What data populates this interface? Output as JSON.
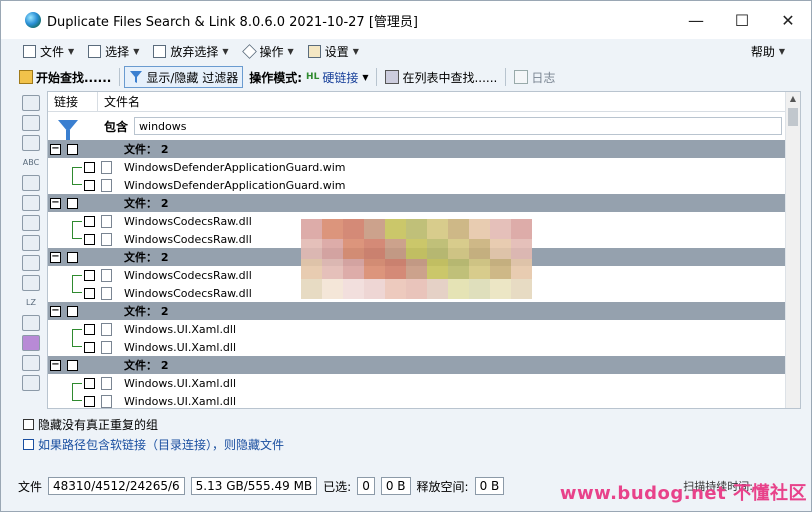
{
  "window": {
    "title": "Duplicate Files Search & Link 8.0.6.0 2021-10-27 [管理员]",
    "controls": {
      "minimize": "—",
      "maximize": "☐",
      "close": "✕"
    }
  },
  "menu": {
    "items": [
      {
        "label": "文件",
        "icon": "file-icon"
      },
      {
        "label": "选择",
        "icon": "check-icon"
      },
      {
        "label": "放弃选择",
        "icon": "uncheck-icon"
      },
      {
        "label": "操作",
        "icon": "diamond-icon"
      },
      {
        "label": "设置",
        "icon": "settings-icon"
      }
    ],
    "help": "帮助"
  },
  "toolbar": {
    "start_search": "开始查找......",
    "show_hide_filter": "显示/隐藏 过滤器",
    "mode_label": "操作模式:",
    "mode_value": "硬链接",
    "mode_badge": "HL",
    "find_in_list": "在列表中查找......",
    "log": "日志"
  },
  "lefttools": {
    "abc": "ABC",
    "lz": "LZ"
  },
  "list": {
    "col_link": "链接",
    "col_name": "文件名",
    "filter_label": "包含",
    "filter_value": "windows",
    "groups": [
      {
        "label": "文件： 2",
        "files": [
          "WindowsDefenderApplicationGuard.wim",
          "WindowsDefenderApplicationGuard.wim"
        ]
      },
      {
        "label": "文件： 2",
        "files": [
          "WindowsCodecsRaw.dll",
          "WindowsCodecsRaw.dll"
        ]
      },
      {
        "label": "文件： 2",
        "files": [
          "WindowsCodecsRaw.dll",
          "WindowsCodecsRaw.dll"
        ]
      },
      {
        "label": "文件： 2",
        "files": [
          "Windows.UI.Xaml.dll",
          "Windows.UI.Xaml.dll"
        ]
      },
      {
        "label": "文件： 2",
        "files": [
          "Windows.UI.Xaml.dll",
          "Windows.UI.Xaml.dll"
        ]
      }
    ]
  },
  "options": {
    "hide_groups": "隐藏没有真正重复的组",
    "hide_symlinks": "如果路径包含软链接（目录连接），则隐藏文件"
  },
  "status": {
    "files_label": "文件",
    "files_counts": "48310/4512/24265/6",
    "sizes": "5.13 GB/555.49 MB",
    "selected_label": "已选:",
    "selected_count": "0",
    "selected_size": "0 B",
    "free_label": "释放空间:",
    "free_value": "0 B",
    "scan_note": "扫描持续时间:",
    "watermark": "www.budog.net 不懂社区"
  },
  "colors": {
    "group_row": "#95a1ae",
    "bracket": "#2f8a2f",
    "filter_funnel": "#3a7fd0",
    "watermark": "#e8428a"
  }
}
